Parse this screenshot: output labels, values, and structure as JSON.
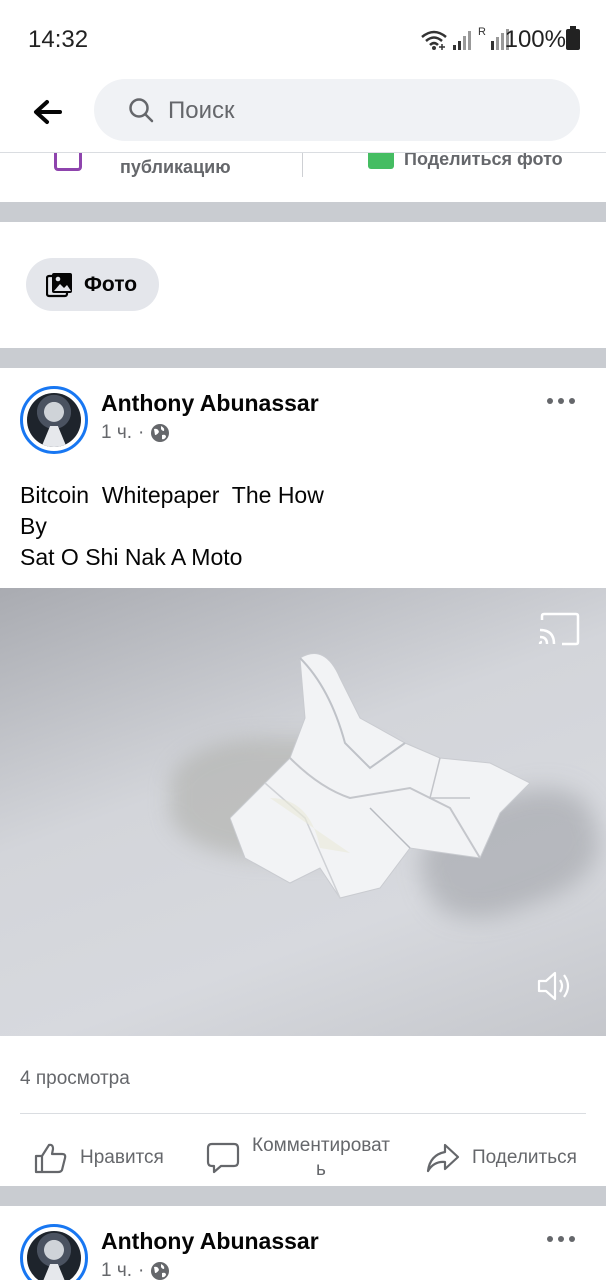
{
  "status_bar": {
    "time": "14:32",
    "battery": "100%",
    "roaming_indicator": "R",
    "icons": [
      "wifi-icon",
      "signal-icon",
      "signal-roaming-icon",
      "battery-icon"
    ]
  },
  "search": {
    "placeholder": "Поиск",
    "back_icon": "back-arrow-icon",
    "search_icon": "search-icon"
  },
  "composer": {
    "left_label": "публикацию",
    "right_label": "Поделиться фото"
  },
  "photo_chip": {
    "label": "Фото"
  },
  "posts": [
    {
      "author": "Anthony Abunassar",
      "time": "1 ч.",
      "separator": "·",
      "text": "Bitcoin  Whitepaper  The How\nBy\nSat O Shi Nak A Moto",
      "views": "4 просмотра",
      "actions": {
        "like": "Нравится",
        "comment": "Комментироват\nь",
        "share": "Поделиться"
      }
    },
    {
      "author": "Anthony Abunassar",
      "time": "1 ч.",
      "separator": "·"
    }
  ],
  "colors": {
    "accent": "#1877f2",
    "separator": "#c9ccd1",
    "secondary_text": "#65676b",
    "chip_bg": "#e4e6eb",
    "search_bg": "#f0f2f5"
  }
}
